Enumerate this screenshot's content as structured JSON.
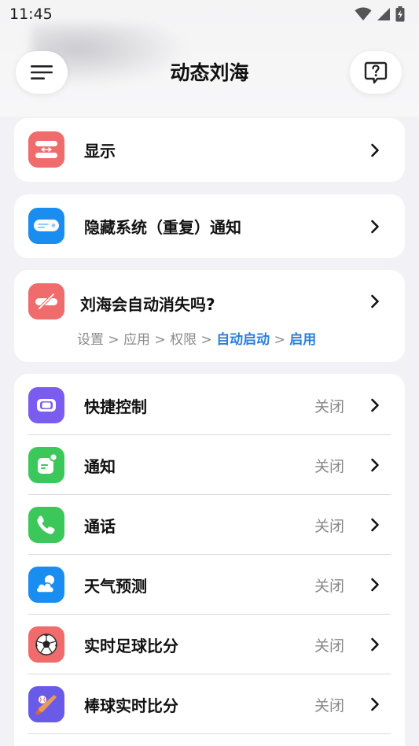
{
  "status_bar": {
    "time": "11:45"
  },
  "app_bar": {
    "title": "动态刘海"
  },
  "settings": {
    "display": {
      "label": "显示"
    },
    "hide_duplicate": {
      "label": "隐藏系统（重复）通知"
    },
    "auto_hide": {
      "label": "刘海会自动消失吗?",
      "path": {
        "settings": "设置",
        "apps": "应用",
        "permissions": "权限",
        "autostart": "自动启动",
        "enable": "启用",
        "sep": " > "
      }
    },
    "features": [
      {
        "label": "快捷控制",
        "value": "关闭",
        "color": "#7b5cf0",
        "icon": "quick-control-icon"
      },
      {
        "label": "通知",
        "value": "关闭",
        "color": "#3cc75a",
        "icon": "notification-icon"
      },
      {
        "label": "通话",
        "value": "关闭",
        "color": "#3cc75a",
        "icon": "phone-icon"
      },
      {
        "label": "天气预测",
        "value": "关闭",
        "color": "#1a8ef0",
        "icon": "weather-icon"
      },
      {
        "label": "实时足球比分",
        "value": "关闭",
        "color": "#f06b6b",
        "icon": "soccer-ball-icon"
      },
      {
        "label": "棒球实时比分",
        "value": "关闭",
        "color": "#6a5ae8",
        "icon": "baseball-icon"
      }
    ]
  },
  "colors": {
    "red_icon": "#f06b6b",
    "blue_icon": "#1a8ef0",
    "path_highlight": "#2a7fd9"
  }
}
